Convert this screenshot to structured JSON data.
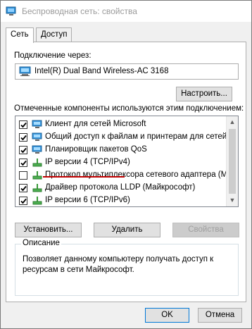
{
  "window": {
    "title": "Беспроводная сеть: свойства"
  },
  "tabs": [
    {
      "label": "Сеть",
      "active": true
    },
    {
      "label": "Доступ",
      "active": false
    }
  ],
  "connect_using": {
    "label": "Подключение через:",
    "adapter_name": "Intel(R) Dual Band Wireless-AC 3168",
    "configure_button": "Настроить..."
  },
  "components": {
    "label": "Отмеченные компоненты используются этим подключением:",
    "items": [
      {
        "label": "Клиент для сетей Microsoft",
        "checked": true,
        "icon": "network-client-icon"
      },
      {
        "label": "Общий доступ к файлам и принтерам для сетей Mi",
        "checked": true,
        "icon": "network-service-icon"
      },
      {
        "label": "Планировщик пакетов QoS",
        "checked": true,
        "icon": "network-service-icon"
      },
      {
        "label": "IP версии 4 (TCP/IPv4)",
        "checked": true,
        "icon": "network-protocol-icon"
      },
      {
        "label": "Протокол мультиплексора сетевого адаптера (Майк",
        "checked": false,
        "icon": "network-protocol-icon"
      },
      {
        "label": "Драйвер протокола LLDP (Майкрософт)",
        "checked": true,
        "icon": "network-protocol-icon"
      },
      {
        "label": "IP версии 6 (TCP/IPv6)",
        "checked": true,
        "icon": "network-protocol-icon"
      }
    ],
    "highlight_color": "#c00000"
  },
  "buttons": {
    "install": "Установить...",
    "remove": "Удалить",
    "properties": "Свойства"
  },
  "description": {
    "title": "Описание",
    "text": "Позволяет данному компьютеру получать доступ к ресурсам в сети Майкрософт."
  },
  "footer": {
    "ok": "OK",
    "cancel": "Отмена"
  }
}
